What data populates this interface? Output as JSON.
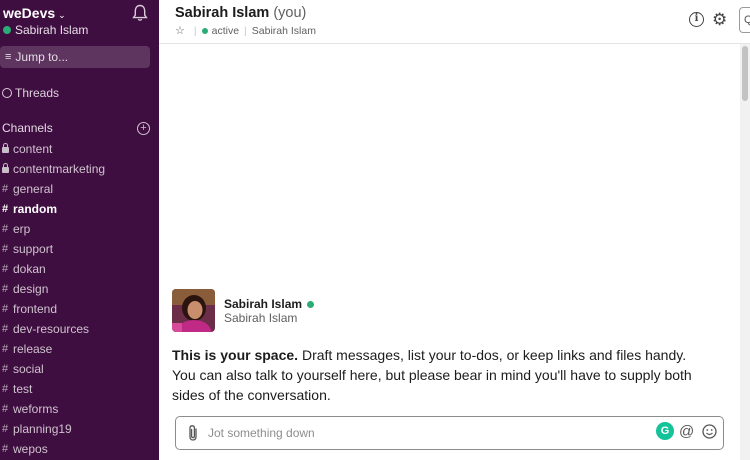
{
  "workspace": {
    "name": "weDevs",
    "user": "Sabirah Islam"
  },
  "sidebar": {
    "jump_label": "Jump to...",
    "threads_label": "Threads",
    "channels_header": "Channels",
    "channels": [
      {
        "name": "content",
        "prefix": "lock",
        "active": false
      },
      {
        "name": "contentmarketing",
        "prefix": "lock",
        "active": false
      },
      {
        "name": "general",
        "prefix": "#",
        "active": false
      },
      {
        "name": "random",
        "prefix": "#",
        "active": true
      },
      {
        "name": "erp",
        "prefix": "#",
        "active": false
      },
      {
        "name": "support",
        "prefix": "#",
        "active": false
      },
      {
        "name": "dokan",
        "prefix": "#",
        "active": false
      },
      {
        "name": "design",
        "prefix": "#",
        "active": false
      },
      {
        "name": "frontend",
        "prefix": "#",
        "active": false
      },
      {
        "name": "dev-resources",
        "prefix": "#",
        "active": false
      },
      {
        "name": "release",
        "prefix": "#",
        "active": false
      },
      {
        "name": "social",
        "prefix": "#",
        "active": false
      },
      {
        "name": "test",
        "prefix": "#",
        "active": false
      },
      {
        "name": "weforms",
        "prefix": "#",
        "active": false
      },
      {
        "name": "planning19",
        "prefix": "#",
        "active": false
      },
      {
        "name": "wepos",
        "prefix": "#",
        "active": false
      }
    ]
  },
  "header": {
    "title": "Sabirah Islam",
    "title_suffix": "(you)",
    "status": "active",
    "subtitle": "Sabirah Islam"
  },
  "intro": {
    "name": "Sabirah Islam",
    "sub": "Sabirah Islam",
    "lead": "This is your space.",
    "body": "Draft messages, list your to-dos, or keep links and files handy. You can also talk to yourself here, but please bear in mind you'll have to supply both sides of the conversation."
  },
  "composer": {
    "placeholder": "Jot something down",
    "value": ""
  },
  "colors": {
    "sidebar_bg": "#3f0e40",
    "presence_green": "#2bac76",
    "grammarly_green": "#15c39a"
  }
}
